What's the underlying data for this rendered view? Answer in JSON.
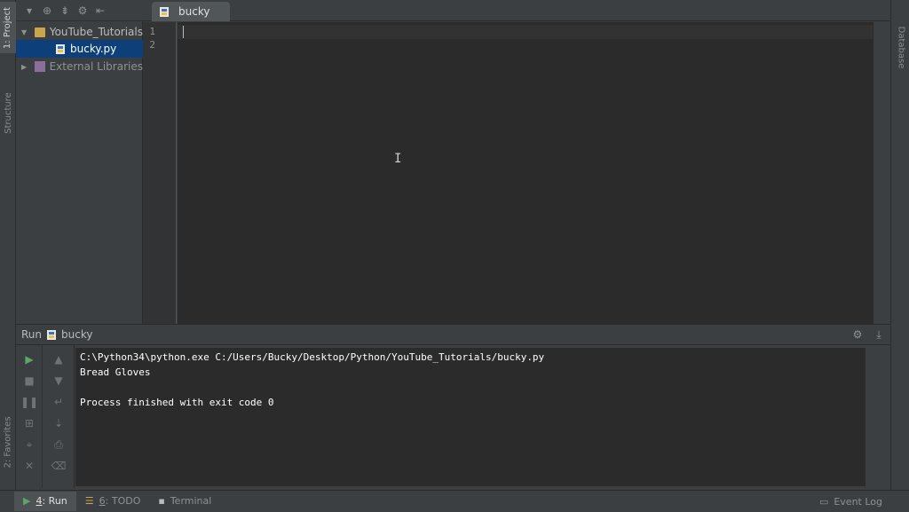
{
  "left_strip": {
    "project_tab": "1: Project",
    "structure_tab": "Structure",
    "favorites_tab": "2: Favorites"
  },
  "right_strip": {
    "database_tab": "Database"
  },
  "project": {
    "root": "YouTube_Tutorials",
    "file": "bucky.py",
    "libraries": "External Libraries"
  },
  "editor": {
    "tab_label": "bucky",
    "line_numbers": [
      "1",
      "2"
    ],
    "ibeam": "I"
  },
  "run": {
    "label": "Run",
    "config": "bucky",
    "output": [
      "C:\\Python34\\python.exe C:/Users/Bucky/Desktop/Python/YouTube_Tutorials/bucky.py",
      "Bread Gloves",
      "",
      "Process finished with exit code 0"
    ]
  },
  "status_bar": {
    "run_num": "4",
    "run_label": ": Run",
    "todo_num": "6",
    "todo_label": ": TODO",
    "terminal": "Terminal",
    "event_log": "Event Log"
  },
  "colors": {
    "accent_selection": "#0d3f7a",
    "editor_bg": "#2b2b2b",
    "panel_bg": "#3c3f41",
    "run_green": "#59a869"
  }
}
